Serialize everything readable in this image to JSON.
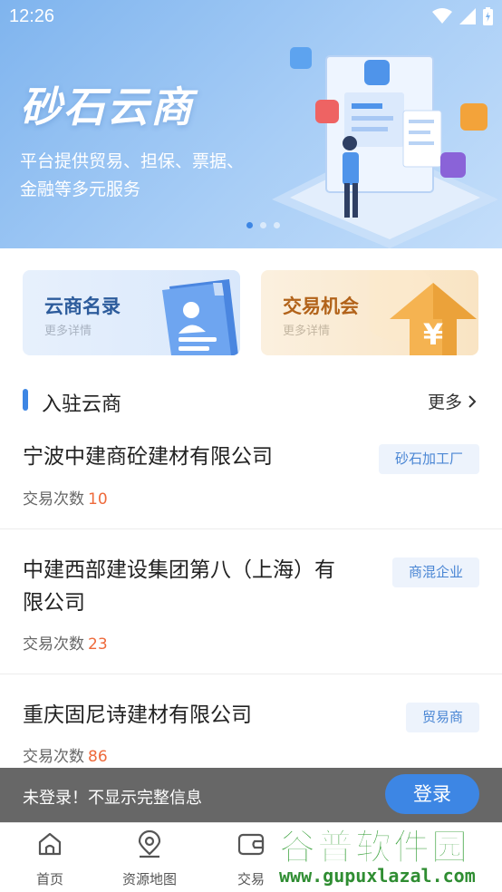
{
  "status_bar": {
    "time": "12:26"
  },
  "banner": {
    "title": "砂石云商",
    "subtitle_line1": "平台提供贸易、担保、票据、",
    "subtitle_line2": "金融等多元服务",
    "carousel_count": 3,
    "active_index": 0
  },
  "quick_cards": [
    {
      "title": "云商名录",
      "subtitle": "更多详情"
    },
    {
      "title": "交易机会",
      "subtitle": "更多详情"
    }
  ],
  "section": {
    "title": "入驻云商",
    "more_label": "更多"
  },
  "list": [
    {
      "name": "宁波中建商砼建材有限公司",
      "count_label": "交易次数",
      "count": "10",
      "tag": "砂石加工厂"
    },
    {
      "name_line1": "中建西部建设集团第八（上海）有",
      "name_line2": "限公司",
      "count_label": "交易次数",
      "count": "23",
      "tag": "商混企业"
    },
    {
      "name": "重庆固尼诗建材有限公司",
      "count_label": "交易次数",
      "count": "86",
      "tag": "贸易商"
    }
  ],
  "login_prompt": {
    "text": "未登录！不显示完整信息",
    "button_label": "登录"
  },
  "tabs": [
    {
      "label": "首页",
      "icon": "home-icon"
    },
    {
      "label": "资源地图",
      "icon": "map-pin-icon"
    },
    {
      "label": "交易",
      "icon": "wallet-icon"
    }
  ],
  "watermark": {
    "title": "谷普软件园",
    "url": "www.gupuxlazal.com"
  },
  "colors": {
    "accent": "#3d86e4",
    "count": "#ee6a3b",
    "tag_text": "#4a86d4",
    "tag_bg": "#edf3fc"
  }
}
